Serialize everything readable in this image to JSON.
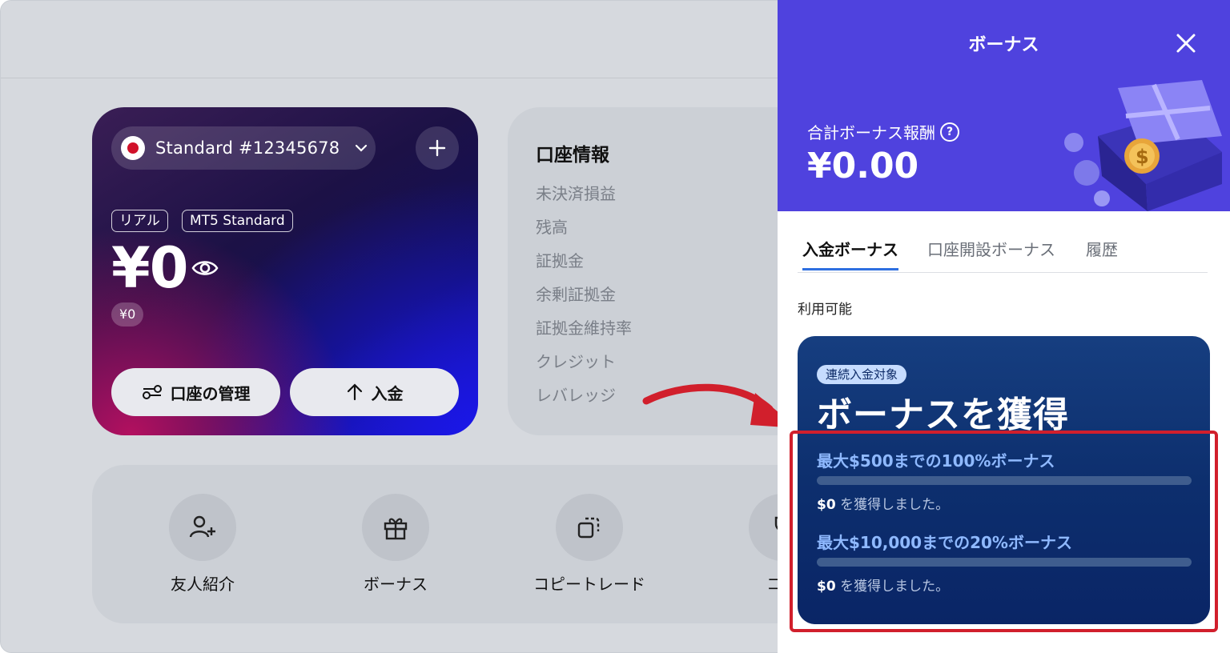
{
  "account_card": {
    "account_name": "Standard #12345678",
    "tags": [
      "リアル",
      "MT5 Standard"
    ],
    "balance": "¥0",
    "sub_balance": "¥0",
    "manage_label": "口座の管理",
    "deposit_label": "入金"
  },
  "account_info": {
    "title": "口座情報",
    "items": [
      "未決済損益",
      "残高",
      "証拠金",
      "余剰証拠金",
      "証拠金維持率",
      "クレジット",
      "レバレッジ"
    ]
  },
  "quick_actions": [
    "友人紹介",
    "ボーナス",
    "コピートレード",
    "コン"
  ],
  "bonus_panel": {
    "title": "ボーナス",
    "total_label": "合計ボーナス報酬",
    "total_amount": "¥0.00",
    "tabs": [
      "入金ボーナス",
      "口座開設ボーナス",
      "履歴"
    ],
    "available_label": "利用可能",
    "card": {
      "pill": "連続入金対象",
      "headline": "ボーナスを獲得",
      "offers": [
        {
          "title": "最大$500までの100%ボーナス",
          "earned_amount": "$0",
          "earned_text": "を獲得しました。",
          "progress": 0
        },
        {
          "title": "最大$10,000までの20%ボーナス",
          "earned_amount": "$0",
          "earned_text": "を獲得しました。",
          "progress": 0
        }
      ]
    }
  },
  "colors": {
    "panel_header": "#4f42de",
    "highlight": "#d11f2c",
    "tab_active": "#2e6fe0",
    "bonus_card": "#0d2f6e"
  }
}
